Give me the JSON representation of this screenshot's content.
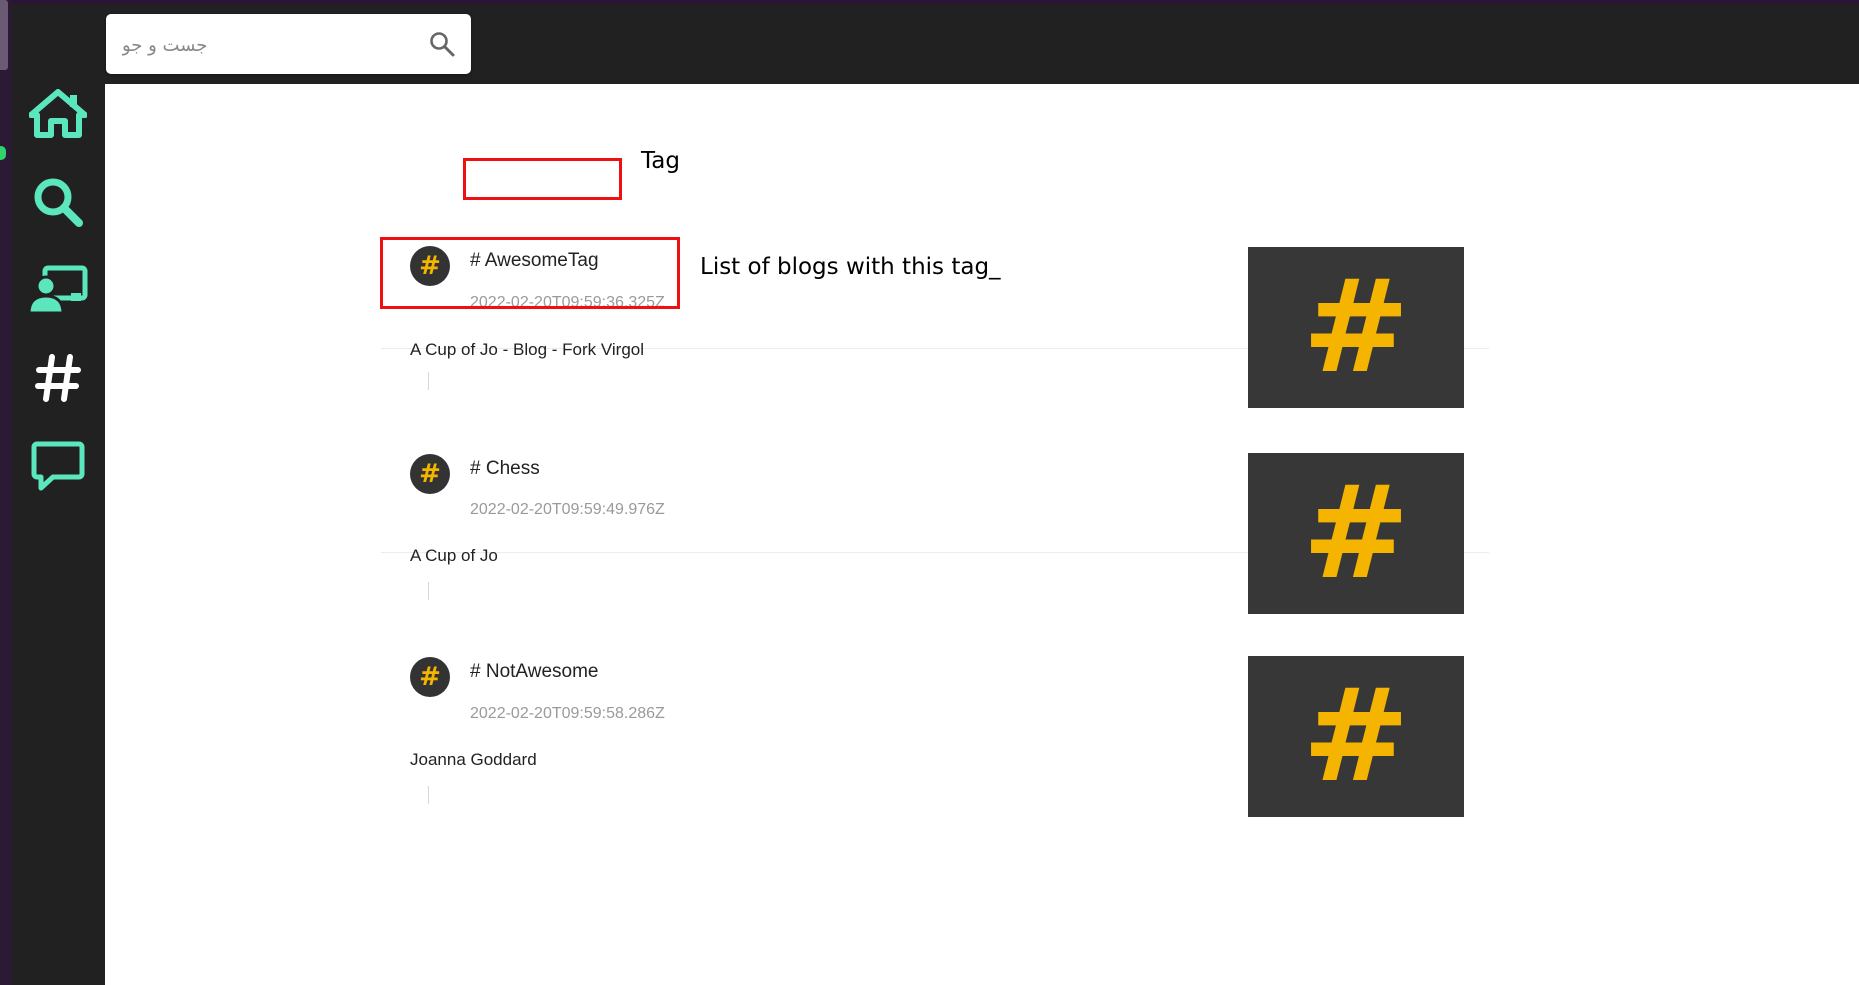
{
  "window": {
    "frame_color": "#2b1a33",
    "status_dot_color": "#2fd36a"
  },
  "sidebar": {
    "background": "#212121",
    "accent": "#5ce6bd",
    "items": [
      {
        "name": "home-icon"
      },
      {
        "name": "search-icon"
      },
      {
        "name": "user-screen-icon"
      },
      {
        "name": "hashtag-icon"
      },
      {
        "name": "chat-bubble-icon"
      }
    ]
  },
  "header": {
    "search": {
      "placeholder": "جست و جو",
      "value": "",
      "icon": "search-icon"
    }
  },
  "tags": [
    {
      "title": "# AwesomeTag",
      "date": "2022-02-20T09:59:36.325Z",
      "blogs": "A Cup of Jo - Blog - Fork Virgol",
      "avatar_glyph": "#",
      "thumb_glyph": "#"
    },
    {
      "title": "# Chess",
      "date": "2022-02-20T09:59:49.976Z",
      "blogs": "A Cup of Jo",
      "avatar_glyph": "#",
      "thumb_glyph": "#"
    },
    {
      "title": "# NotAwesome",
      "date": "2022-02-20T09:59:58.286Z",
      "blogs": "Joanna Goddard",
      "avatar_glyph": "#",
      "thumb_glyph": "#"
    }
  ],
  "annotations": {
    "tag_label": "Tag",
    "blogs_label": "List of blogs with this tag_",
    "color": "#ee1111"
  },
  "colors": {
    "tag_accent": "#f5b400",
    "thumb_bg": "#373737"
  }
}
